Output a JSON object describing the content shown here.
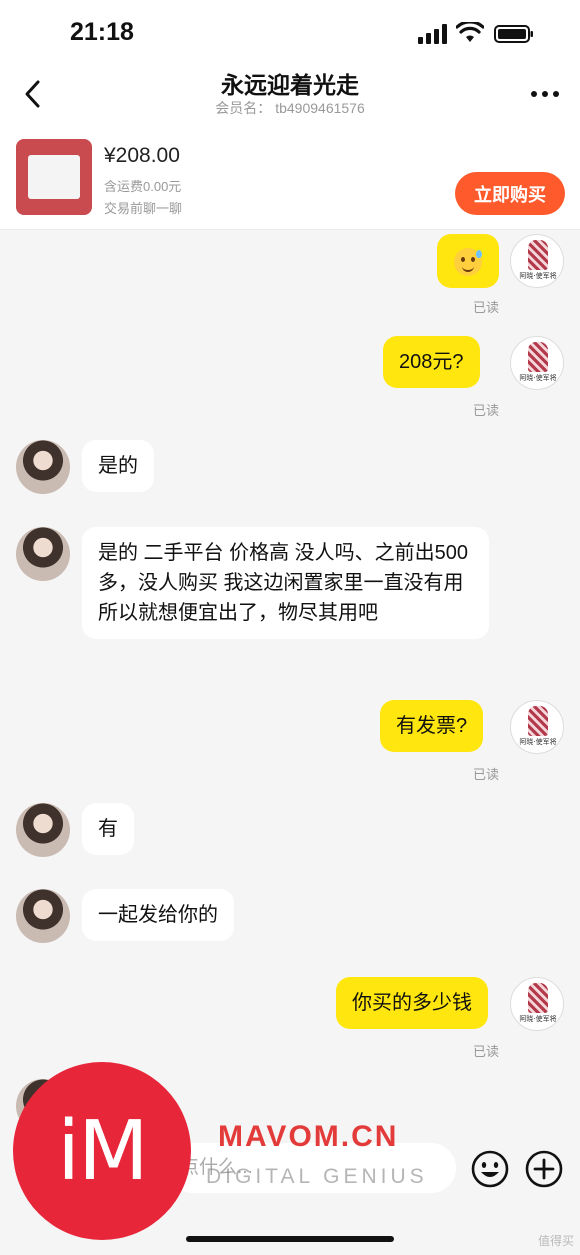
{
  "status_bar": {
    "time": "21:18"
  },
  "header": {
    "title": "永远迎着光走",
    "member_label": "会员名：",
    "member_id": "tb4909461576"
  },
  "product": {
    "price": "¥208.00",
    "shipping": "含运费0.00元",
    "pretrade": "交易前聊一聊",
    "buy_label": "立即购买",
    "accent_color": "#ff5a2b"
  },
  "buyer_avatar": {
    "caption": "阿晓·使军将"
  },
  "messages": [
    {
      "from": "buyer",
      "type": "emoji",
      "emoji_name": "sweating-grin-emoji",
      "read": "已读"
    },
    {
      "from": "buyer",
      "text": "208元?",
      "read": "已读"
    },
    {
      "from": "seller",
      "text": "是的"
    },
    {
      "from": "seller",
      "text": "是的 二手平台 价格高 没人吗、之前出500多，没人购买 我这边闲置家里一直没有用 所以就想便宜出了，物尽其用吧"
    },
    {
      "from": "buyer",
      "text": "有发票?",
      "read": "已读"
    },
    {
      "from": "seller",
      "text": "有"
    },
    {
      "from": "seller",
      "text": "一起发给你的"
    },
    {
      "from": "buyer",
      "text": "你买的多少钱",
      "read": "已读"
    }
  ],
  "input": {
    "placeholder_fragment": "点什么..."
  },
  "colors": {
    "outgoing_bubble": "#ffe60f",
    "incoming_bubble": "#ffffff",
    "background": "#f5f5f5"
  },
  "watermark": {
    "logo_text": "iM",
    "brand": "MAVOM.CN",
    "tagline": "DIGITAL GENIUS",
    "corner": "值得买"
  }
}
